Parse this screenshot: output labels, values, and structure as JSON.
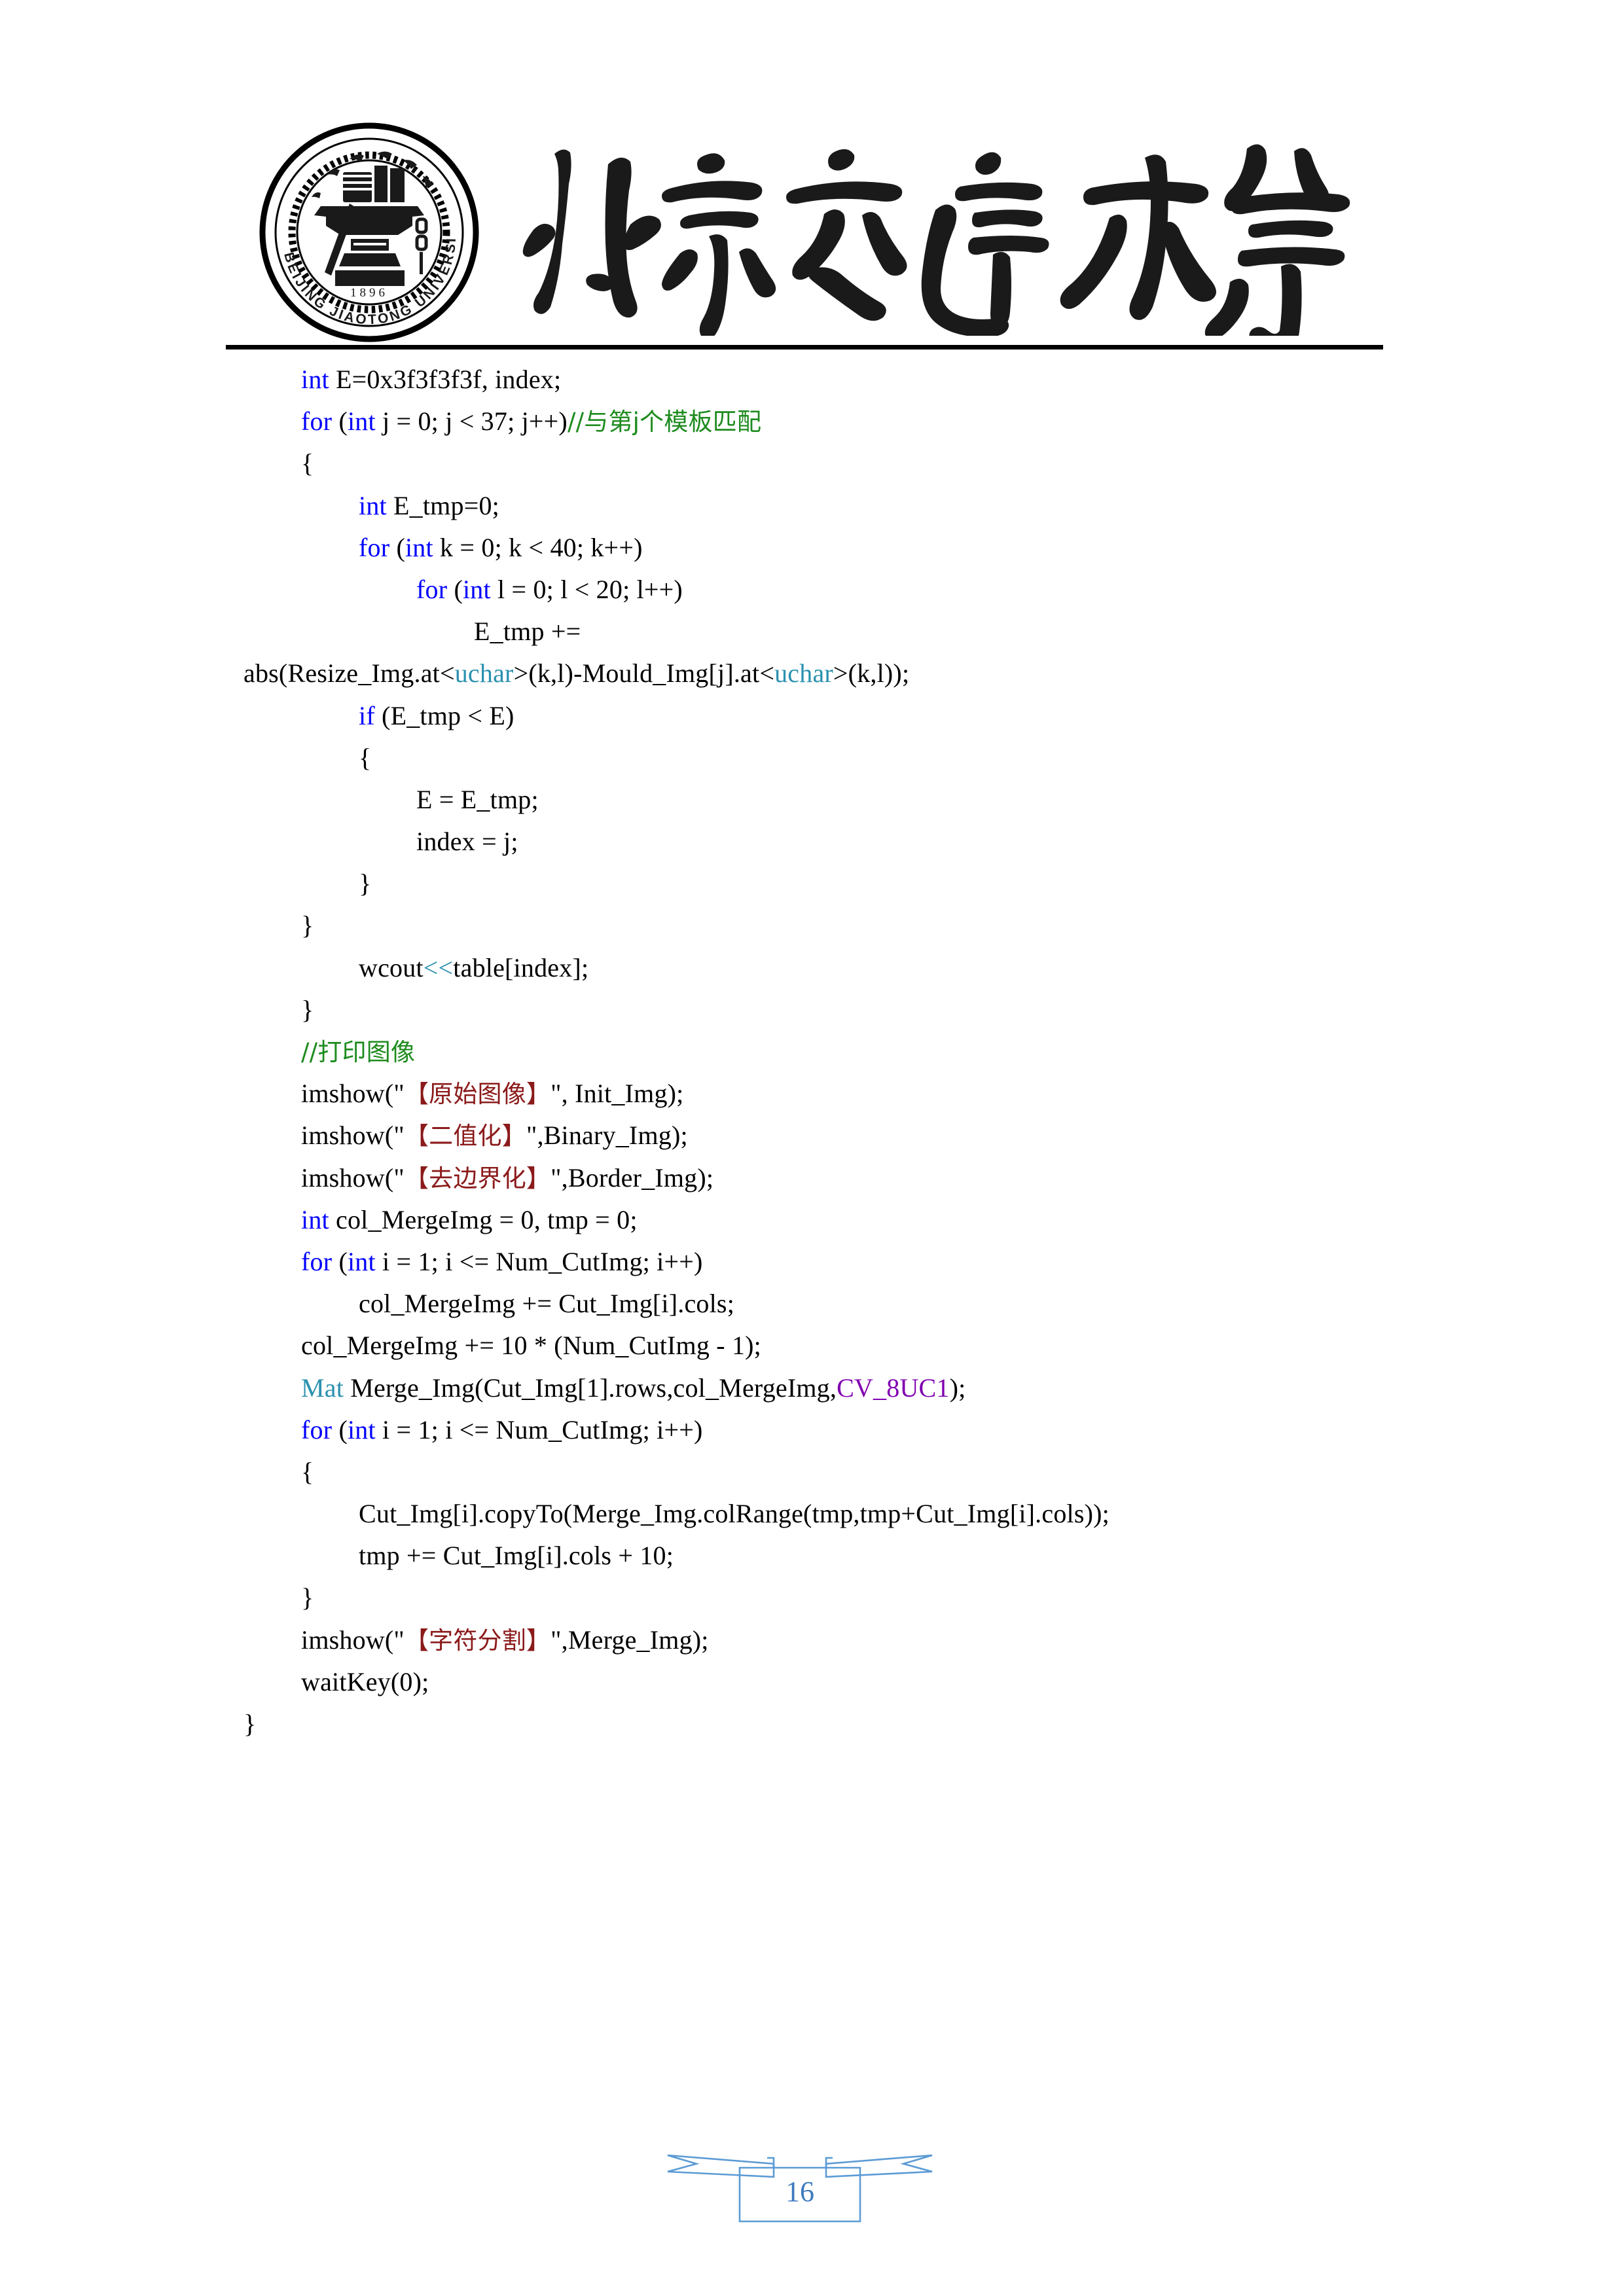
{
  "header": {
    "seal_text_top": "北京交通大学",
    "seal_text_outer_left": "BEIJING",
    "seal_text_outer_bottom": "JIAOTONG",
    "seal_text_outer_right": "UNIVERSITY",
    "seal_year": "1896",
    "university_name_cjk": "北京交通大学"
  },
  "code": {
    "lines": [
      {
        "indent": 1,
        "tokens": [
          {
            "t": "int",
            "c": "kw"
          },
          {
            "t": " E=0x3f3f3f3f, index;",
            "c": ""
          }
        ]
      },
      {
        "indent": 1,
        "tokens": [
          {
            "t": "for",
            "c": "kw"
          },
          {
            "t": " (",
            "c": ""
          },
          {
            "t": "int",
            "c": "kw"
          },
          {
            "t": " j = 0; j < 37; j++)",
            "c": ""
          },
          {
            "t": "//与第j个模板匹配",
            "c": "cm"
          }
        ]
      },
      {
        "indent": 1,
        "tokens": [
          {
            "t": "{",
            "c": ""
          }
        ]
      },
      {
        "indent": 2,
        "tokens": [
          {
            "t": "int",
            "c": "kw"
          },
          {
            "t": " E_tmp=0;",
            "c": ""
          }
        ]
      },
      {
        "indent": 2,
        "tokens": [
          {
            "t": "for",
            "c": "kw"
          },
          {
            "t": " (",
            "c": ""
          },
          {
            "t": "int",
            "c": "kw"
          },
          {
            "t": " k = 0; k < 40; k++)",
            "c": ""
          }
        ]
      },
      {
        "indent": 3,
        "tokens": [
          {
            "t": "for",
            "c": "kw"
          },
          {
            "t": " (",
            "c": ""
          },
          {
            "t": "int",
            "c": "kw"
          },
          {
            "t": " l = 0; l < 20; l++)",
            "c": ""
          }
        ]
      },
      {
        "indent": 4,
        "tokens": [
          {
            "t": "E_tmp +=",
            "c": ""
          }
        ]
      },
      {
        "indent": 0,
        "tokens": [
          {
            "t": "abs(Resize_Img.at<",
            "c": ""
          },
          {
            "t": "uchar",
            "c": "ty"
          },
          {
            "t": ">(k,l)-Mould_Img[j].at<",
            "c": ""
          },
          {
            "t": "uchar",
            "c": "ty"
          },
          {
            "t": ">(k,l));",
            "c": ""
          }
        ]
      },
      {
        "indent": 2,
        "tokens": [
          {
            "t": "if",
            "c": "kw"
          },
          {
            "t": " (E_tmp < E)",
            "c": ""
          }
        ]
      },
      {
        "indent": 2,
        "tokens": [
          {
            "t": "{",
            "c": ""
          }
        ]
      },
      {
        "indent": 3,
        "tokens": [
          {
            "t": "E = E_tmp;",
            "c": ""
          }
        ]
      },
      {
        "indent": 3,
        "tokens": [
          {
            "t": "index = j;",
            "c": ""
          }
        ]
      },
      {
        "indent": 2,
        "tokens": [
          {
            "t": "}",
            "c": ""
          }
        ]
      },
      {
        "indent": 1,
        "tokens": [
          {
            "t": "}",
            "c": ""
          }
        ]
      },
      {
        "indent": 2,
        "tokens": [
          {
            "t": "wcout",
            "c": ""
          },
          {
            "t": "<<",
            "c": "op"
          },
          {
            "t": "table[index];",
            "c": ""
          }
        ]
      },
      {
        "indent": 1,
        "tokens": [
          {
            "t": "}",
            "c": ""
          }
        ]
      },
      {
        "indent": 1,
        "tokens": [
          {
            "t": "//打印图像",
            "c": "cm"
          }
        ]
      },
      {
        "indent": 1,
        "tokens": [
          {
            "t": "imshow(\"",
            "c": ""
          },
          {
            "t": "【原始图像】",
            "c": "st"
          },
          {
            "t": "\", Init_Img);",
            "c": ""
          }
        ]
      },
      {
        "indent": 1,
        "tokens": [
          {
            "t": "imshow(\"",
            "c": ""
          },
          {
            "t": "【二值化】",
            "c": "st"
          },
          {
            "t": "\",Binary_Img);",
            "c": ""
          }
        ]
      },
      {
        "indent": 1,
        "tokens": [
          {
            "t": "imshow(\"",
            "c": ""
          },
          {
            "t": "【去边界化】",
            "c": "st"
          },
          {
            "t": "\",Border_Img);",
            "c": ""
          }
        ]
      },
      {
        "indent": 1,
        "tokens": [
          {
            "t": "int",
            "c": "kw"
          },
          {
            "t": " col_MergeImg = 0, tmp = 0;",
            "c": ""
          }
        ]
      },
      {
        "indent": 1,
        "tokens": [
          {
            "t": "for",
            "c": "kw"
          },
          {
            "t": " (",
            "c": ""
          },
          {
            "t": "int",
            "c": "kw"
          },
          {
            "t": " i = 1; i <= Num_CutImg; i++)",
            "c": ""
          }
        ]
      },
      {
        "indent": 2,
        "tokens": [
          {
            "t": "col_MergeImg += Cut_Img[i].cols;",
            "c": ""
          }
        ]
      },
      {
        "indent": 1,
        "tokens": [
          {
            "t": "col_MergeImg += 10 * (Num_CutImg - 1);",
            "c": ""
          }
        ]
      },
      {
        "indent": 1,
        "tokens": [
          {
            "t": "Mat",
            "c": "ty"
          },
          {
            "t": " Merge_Img(Cut_Img[1].rows,col_MergeImg,",
            "c": ""
          },
          {
            "t": "CV_8UC1",
            "c": "mc"
          },
          {
            "t": ");",
            "c": ""
          }
        ]
      },
      {
        "indent": 1,
        "tokens": [
          {
            "t": "for",
            "c": "kw"
          },
          {
            "t": " (",
            "c": ""
          },
          {
            "t": "int",
            "c": "kw"
          },
          {
            "t": " i = 1; i <= Num_CutImg; i++)",
            "c": ""
          }
        ]
      },
      {
        "indent": 1,
        "tokens": [
          {
            "t": "{",
            "c": ""
          }
        ]
      },
      {
        "indent": 2,
        "tokens": [
          {
            "t": "Cut_Img[i].copyTo(Merge_Img.colRange(tmp,tmp+Cut_Img[i].cols));",
            "c": ""
          }
        ]
      },
      {
        "indent": 2,
        "tokens": [
          {
            "t": "tmp += Cut_Img[i].cols + 10;",
            "c": ""
          }
        ]
      },
      {
        "indent": 1,
        "tokens": [
          {
            "t": "}",
            "c": ""
          }
        ]
      },
      {
        "indent": 1,
        "tokens": [
          {
            "t": "imshow(\"",
            "c": ""
          },
          {
            "t": "【字符分割】",
            "c": "st"
          },
          {
            "t": "\",Merge_Img);",
            "c": ""
          }
        ]
      },
      {
        "indent": 1,
        "tokens": [
          {
            "t": "waitKey(0);",
            "c": ""
          }
        ]
      },
      {
        "indent": 0,
        "tokens": [
          {
            "t": "}",
            "c": ""
          }
        ]
      }
    ]
  },
  "footer": {
    "page_number": "16"
  },
  "colors": {
    "keyword": "#0000ff",
    "type": "#2b91af",
    "comment": "#1e8b1e",
    "string": "#8b1a1a",
    "macro": "#8000b0",
    "ribbon": "#5b9bd5",
    "rule": "#000000"
  }
}
